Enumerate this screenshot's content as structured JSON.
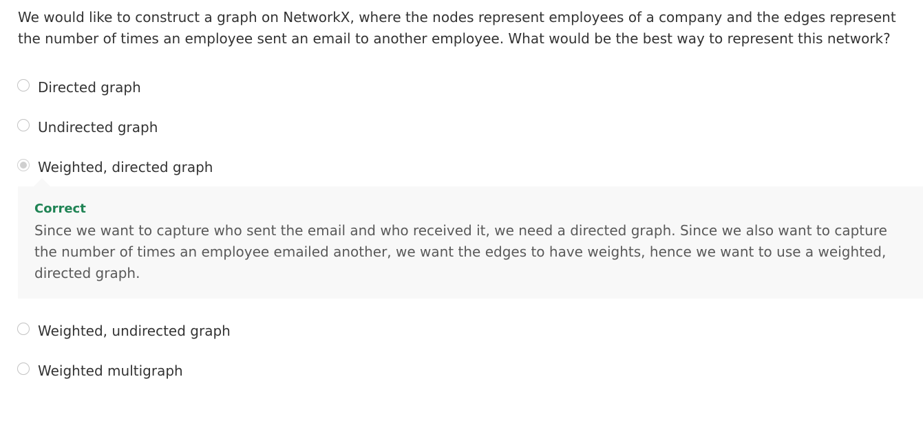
{
  "question": {
    "text": "We would like to construct a graph on NetworkX, where the nodes represent employees of a company and the edges represent the number of times an employee sent an email to another employee. What would be the best way to represent this network?"
  },
  "options": [
    {
      "label": "Directed graph",
      "selected": false
    },
    {
      "label": "Undirected graph",
      "selected": false
    },
    {
      "label": "Weighted, directed graph",
      "selected": true
    },
    {
      "label": "Weighted, undirected graph",
      "selected": false
    },
    {
      "label": "Weighted multigraph",
      "selected": false
    }
  ],
  "feedback": {
    "status": "Correct",
    "explanation": "Since we want to capture who sent the email and who received it, we need a directed graph. Since we also want to capture the number of times an employee emailed another, we want the edges to have weights, hence we want to use a weighted, directed graph."
  },
  "colors": {
    "correct": "#1f8354",
    "feedback_background": "#f8f8f8",
    "text": "#333333",
    "radio_border": "#c2c2c2",
    "radio_selected_fill": "#cfcfcf"
  }
}
